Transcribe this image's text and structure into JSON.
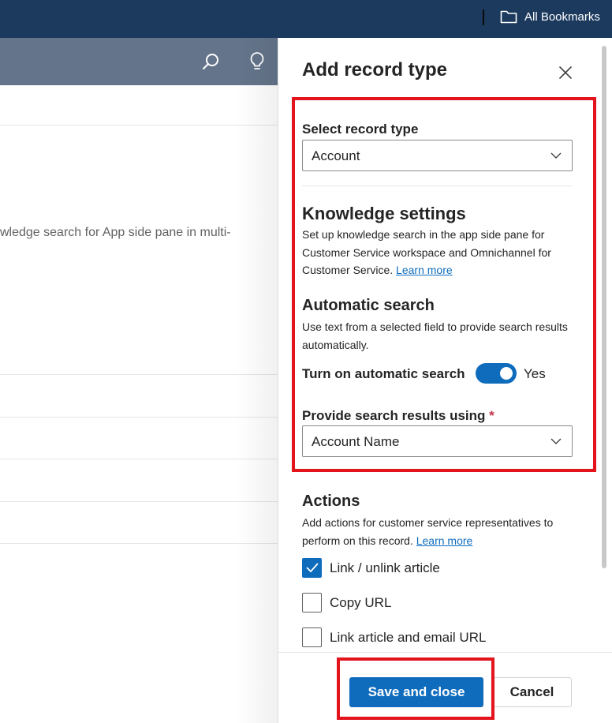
{
  "browser": {
    "bookmarks_label": "All Bookmarks"
  },
  "background": {
    "body_text": "wledge search for App side pane in multi-"
  },
  "panel": {
    "title": "Add record type",
    "record_type": {
      "label": "Select record type",
      "value": "Account"
    },
    "knowledge": {
      "title": "Knowledge settings",
      "description": "Set up knowledge search in the app side pane for Customer Service workspace and Omnichannel for Customer Service.",
      "link": "Learn more"
    },
    "automatic_search": {
      "title": "Automatic search",
      "description": "Use text from a selected field to provide search results automatically.",
      "toggle_label": "Turn on automatic search",
      "toggle_state": "Yes",
      "toggle_on": true
    },
    "search_results": {
      "label": "Provide search results using",
      "required_marker": "*",
      "value": "Account Name"
    },
    "actions": {
      "title": "Actions",
      "description": "Add actions for customer service representatives to perform on this record.",
      "link": "Learn more",
      "items": [
        {
          "label": "Link / unlink article",
          "checked": true
        },
        {
          "label": "Copy URL",
          "checked": false
        },
        {
          "label": "Link article and email URL",
          "checked": false
        }
      ]
    },
    "footer": {
      "save_label": "Save and close",
      "cancel_label": "Cancel"
    }
  },
  "colors": {
    "accent": "#0f6cbd",
    "highlight": "#e3141b",
    "bookmarks_bar": "#1b3a5e",
    "app_header": "#64748a"
  },
  "icons": {
    "folder": "folder-icon",
    "search": "search-icon",
    "lightbulb": "lightbulb-icon",
    "close": "close-icon",
    "chevron": "chevron-down-icon",
    "check": "checkmark-icon"
  }
}
